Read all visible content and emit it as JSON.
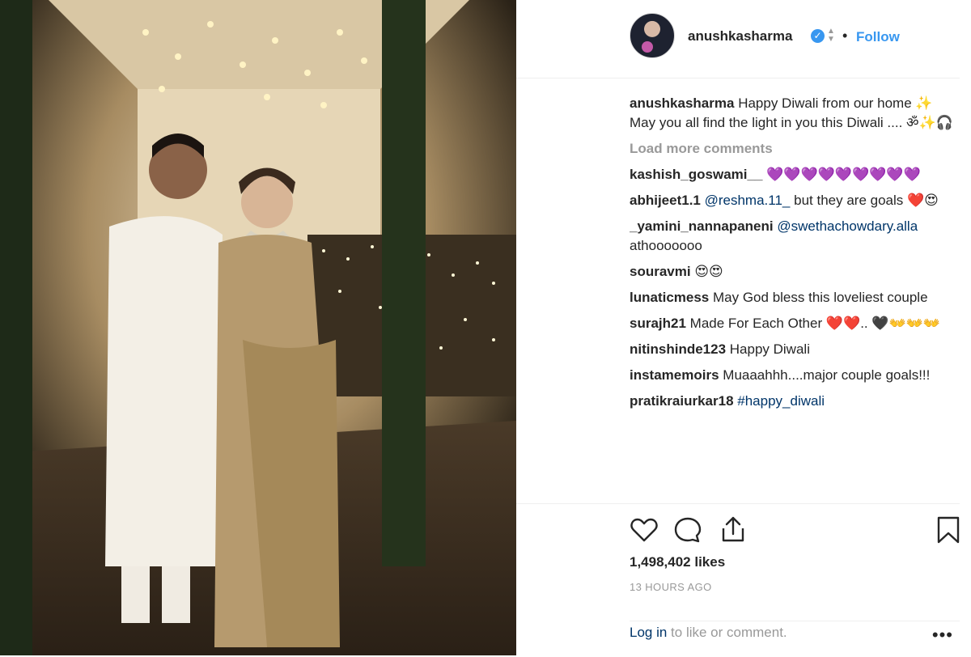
{
  "header": {
    "username": "anushkasharma",
    "verified_mark": "✓",
    "chevron": "⬍",
    "separator": "•",
    "follow_label": "Follow"
  },
  "caption": {
    "username": "anushkasharma",
    "text": "Happy Diwali from our home ✨ May you all find the light in you this Diwali .... ॐ✨🎧"
  },
  "load_more": "Load more comments",
  "comments": [
    {
      "user": "kashish_goswami__",
      "text": "💜💜💜💜💜💜💜💜💜"
    },
    {
      "user": "abhijeet1.1",
      "mention": "@reshma.11_",
      "text": " but they are goals ❤️😍"
    },
    {
      "user": "_yamini_nannapaneni",
      "mention": "@swethachowdary.alla",
      "text": " athooooooo"
    },
    {
      "user": "souravmi",
      "text": "😍😍"
    },
    {
      "user": "lunaticmess",
      "text": "May God bless this loveliest couple"
    },
    {
      "user": "surajh21",
      "text": "Made For Each Other ❤️❤️.. 🖤👐👐👐"
    },
    {
      "user": "nitinshinde123",
      "text": "Happy Diwali"
    },
    {
      "user": "instamemoirs",
      "text": "Muaaahhh....major couple goals!!!"
    },
    {
      "user": "pratikraiurkar18",
      "mention": "#happy_diwali",
      "text": ""
    }
  ],
  "actions": {
    "like_icon": "heart-icon",
    "comment_icon": "comment-icon",
    "share_icon": "share-icon",
    "save_icon": "bookmark-icon"
  },
  "likes": "1,498,402 likes",
  "timestamp": "13 HOURS AGO",
  "footer": {
    "login_link": "Log in",
    "login_rest": " to like or comment.",
    "more": "•••"
  },
  "colors": {
    "link_blue": "#3897f0",
    "muted": "#999999",
    "mention": "#003569"
  }
}
